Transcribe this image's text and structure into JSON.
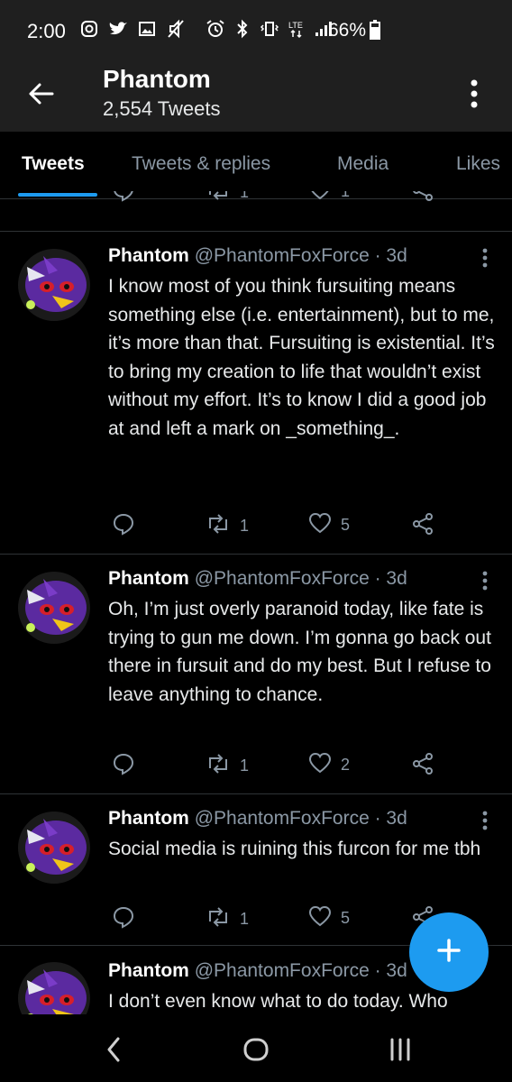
{
  "status_bar": {
    "time": "2:00",
    "battery": "66%",
    "left_icons": [
      "instagram-icon",
      "twitter-icon",
      "gallery-icon",
      "mute-icon"
    ],
    "right_icons": [
      "alarm-icon",
      "bluetooth-icon",
      "vibrate-icon",
      "lte-icon",
      "signal-icon"
    ]
  },
  "header": {
    "title": "Phantom",
    "subtitle": "2,554 Tweets"
  },
  "tabs": [
    {
      "label": "Tweets",
      "active": true
    },
    {
      "label": "Tweets & replies",
      "active": false
    },
    {
      "label": "Media",
      "active": false
    },
    {
      "label": "Likes",
      "active": false
    }
  ],
  "previous_tweet": {
    "retweets": "1",
    "likes": "1"
  },
  "tweets": [
    {
      "name": "Phantom",
      "handle": "@PhantomFoxForce · 3d",
      "text": "I know most of you think fursuiting means something else (i.e. entertainment), but to me, it’s more than that.  Fursuiting is existential.  It’s to bring my creation to life that wouldn’t exist without my effort.  It’s to know I did a good job at and left a mark on _something_.",
      "retweets": "1",
      "likes": "5"
    },
    {
      "name": "Phantom",
      "handle": "@PhantomFoxForce · 3d",
      "text": "Oh, I’m just overly paranoid today, like fate is trying to gun me down.  I’m gonna go back out there in fursuit and do my best.  But I refuse to leave anything to chance.",
      "retweets": "1",
      "likes": "2"
    },
    {
      "name": "Phantom",
      "handle": "@PhantomFoxForce · 3d",
      "text": "Social media is ruining this furcon for me tbh",
      "retweets": "1",
      "likes": "5"
    },
    {
      "name": "Phantom",
      "handle": "@PhantomFoxForce · 3d",
      "text": "I don’t even know what to do today. Who",
      "retweets": "",
      "likes": ""
    }
  ],
  "colors": {
    "background": "#000000",
    "bar": "#1f1f1f",
    "accent": "#1d9bf0",
    "secondary_text": "#8b98a5",
    "avatar_purple": "#5b2aa0"
  }
}
